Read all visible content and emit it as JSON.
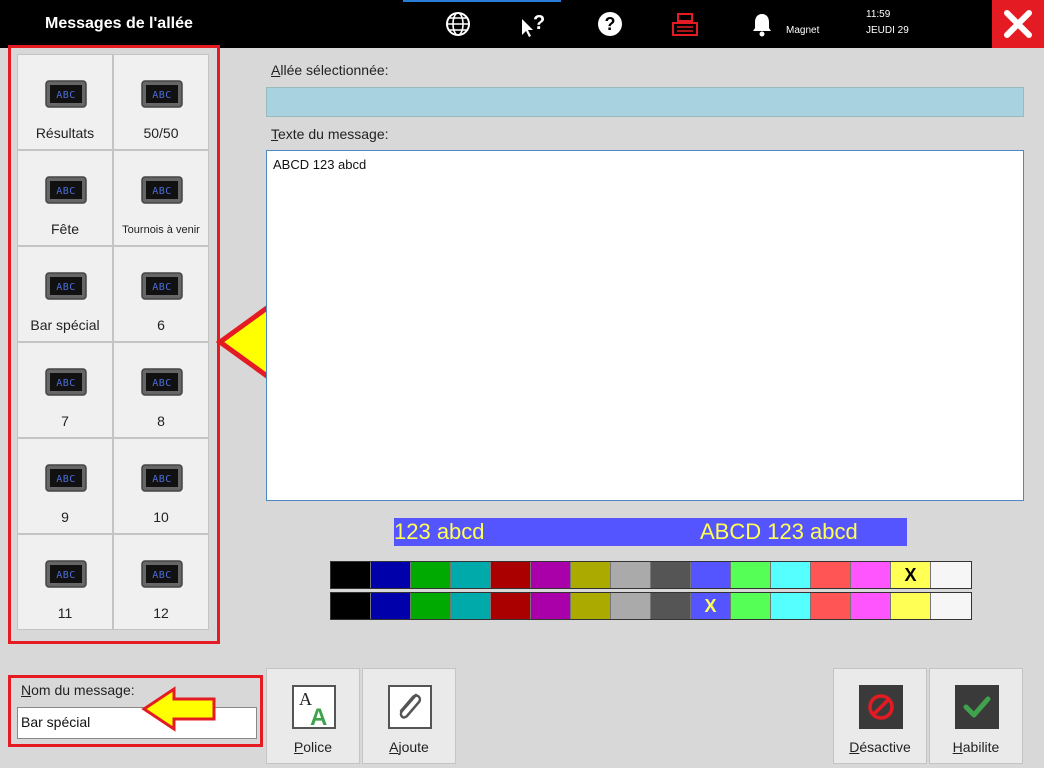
{
  "window": {
    "title": "Messages de l'allée",
    "close_icon": "close-icon"
  },
  "toolbar": {
    "icons": [
      "globe-icon",
      "help-pointer-icon",
      "help-icon",
      "cash-register-icon",
      "bell-icon"
    ],
    "user": "Magnet",
    "time": "11:59",
    "date": "JEUDI 29"
  },
  "messages": [
    {
      "label": "Résultats",
      "icon": "sign-icon"
    },
    {
      "label": "50/50",
      "icon": "sign-icon"
    },
    {
      "label": "Fête",
      "icon": "sign-icon"
    },
    {
      "label": "Tournois à venir",
      "icon": "sign-icon"
    },
    {
      "label": "Bar spécial",
      "icon": "sign-icon"
    },
    {
      "label": "6",
      "icon": "sign-icon"
    },
    {
      "label": "7",
      "icon": "sign-icon"
    },
    {
      "label": "8",
      "icon": "sign-icon"
    },
    {
      "label": "9",
      "icon": "sign-icon"
    },
    {
      "label": "10",
      "icon": "sign-icon"
    },
    {
      "label": "11",
      "icon": "sign-icon"
    },
    {
      "label": "12",
      "icon": "sign-icon"
    }
  ],
  "alley": {
    "label_u": "A",
    "label_rest": "llée sélectionnée:",
    "value": ""
  },
  "message_text": {
    "label_u": "T",
    "label_rest": "exte du message:",
    "value": "ABCD 123 abcd"
  },
  "preview": {
    "left_text": "123 abcd",
    "right_text": "ABCD 123 abcd",
    "bg": "#5555ff",
    "fg": "#ffff55"
  },
  "palette": {
    "colors": [
      "#000000",
      "#0000aa",
      "#00aa00",
      "#00aaaa",
      "#aa0000",
      "#aa00aa",
      "#aaaa00",
      "#aaaaaa",
      "#555555",
      "#5555ff",
      "#55ff55",
      "#55ffff",
      "#ff5555",
      "#ff55ff",
      "#ffff55",
      "#f6f6f6"
    ],
    "foreground_selected_mark": "X",
    "background_selected_mark": "X"
  },
  "message_name": {
    "label_u": "N",
    "label_rest": "om du message:",
    "value": "Bar spécial"
  },
  "buttons": {
    "police": {
      "label_u": "P",
      "label_rest": "olice",
      "icon": "font-icon"
    },
    "ajoute": {
      "label_u": "A",
      "label_rest": "joute",
      "icon": "paperclip-icon"
    },
    "desactive": {
      "label_u": "D",
      "label_rest": "ésactive",
      "icon": "disable-icon"
    },
    "habilite": {
      "label_u": "H",
      "label_rest": "abilite",
      "icon": "checkmark-icon"
    }
  },
  "annotations": [
    "arrow-icon",
    "arrow-icon"
  ]
}
